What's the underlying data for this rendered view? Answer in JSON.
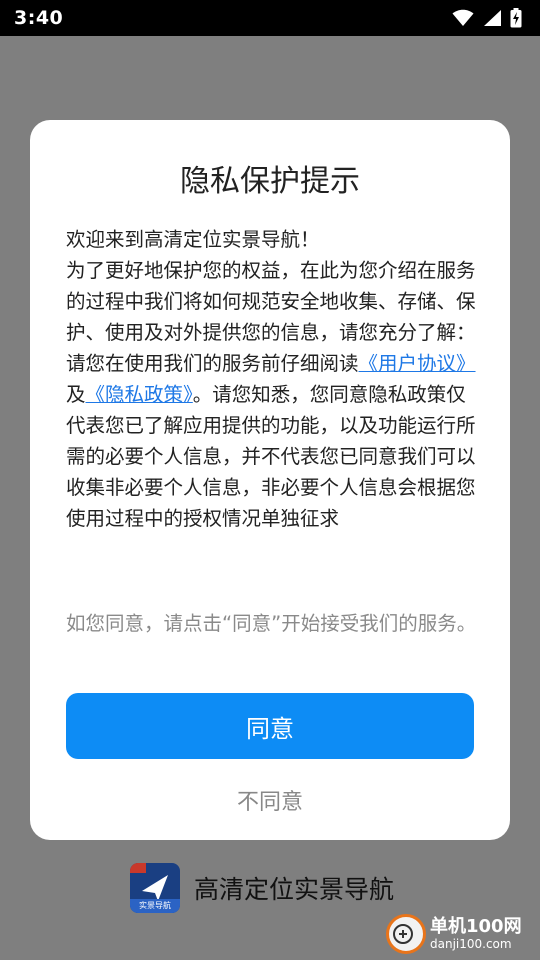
{
  "status_bar": {
    "time": "3:40",
    "icons": [
      "wifi-icon",
      "signal-icon",
      "battery-charging-icon"
    ]
  },
  "dialog": {
    "title": "隐私保护提示",
    "body": {
      "welcome": "欢迎来到高清定位实景导航！",
      "para1": "为了更好地保护您的权益，在此为您介绍在服务的过程中我们将如何规范安全地收集、存储、保护、使用及对外提供您的信息，请您充分了解：",
      "para2_prefix": "请您在使用我们的服务前仔细阅读",
      "user_agreement_link": "《用户协议》",
      "and": "及",
      "privacy_policy_link": "《隐私政策》",
      "para2_suffix": "。请您知悉，您同意隐私政策仅代表您已了解应用提供的功能，以及功能运行所需的必要个人信息，并不代表您已同意我们可以收集非必要个人信息，非必要个人信息会根据您使用过程中的授权情况单独征求"
    },
    "note": "如您同意，请点击“同意”开始接受我们的服务。",
    "agree_label": "同意",
    "disagree_label": "不同意"
  },
  "background_app": {
    "name": "高清定位实景导航",
    "logo_tag": "实景导航"
  },
  "watermark": {
    "title": "单机100网",
    "url": "danji100.com"
  },
  "colors": {
    "accent": "#0d8cf5",
    "link": "#1e78e6",
    "overlay": "#808080"
  }
}
